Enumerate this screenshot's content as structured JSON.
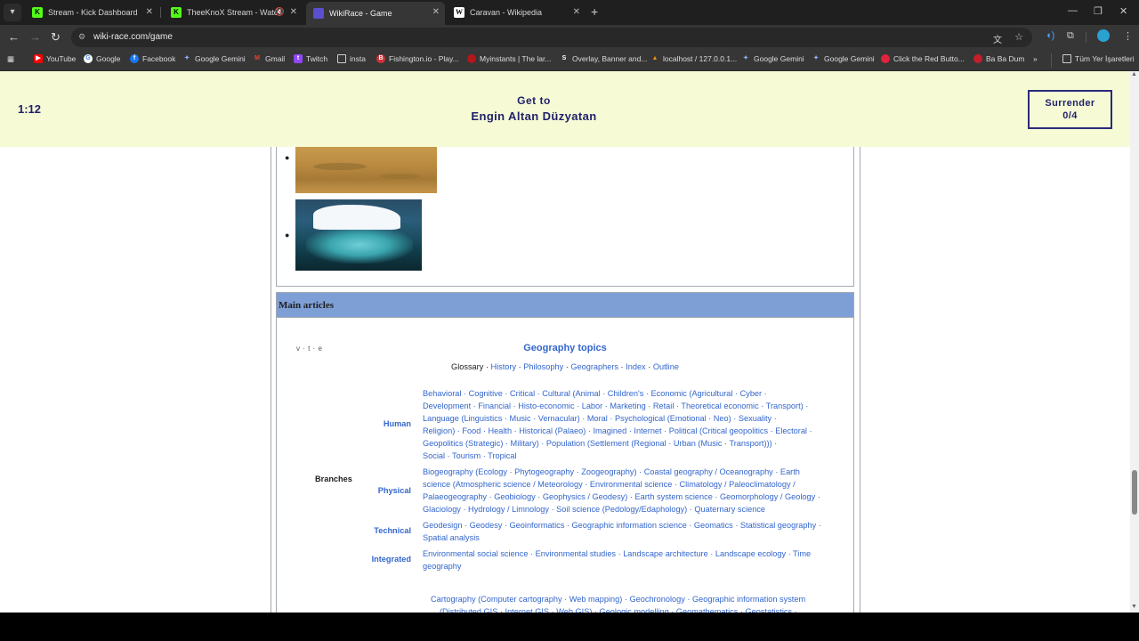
{
  "browser": {
    "tabs": [
      {
        "title": "Stream - Kick Dashboard",
        "fav": "K",
        "favColor": "#53fc18"
      },
      {
        "title": "TheeKnoX Stream - Watch L",
        "fav": "K",
        "favColor": "#53fc18"
      },
      {
        "title": "WikiRace - Game",
        "fav": "",
        "favColor": "#5a4fcf"
      },
      {
        "title": "Caravan - Wikipedia",
        "fav": "W",
        "favColor": "#ffffff"
      }
    ],
    "url": "wiki-race.com/game",
    "bookmarks": [
      "YouTube",
      "Google",
      "Facebook",
      "Google Gemini",
      "Gmail",
      "Twitch",
      "insta",
      "Fishington.io - Play...",
      "Myinstants | The lar...",
      "Overlay, Banner and...",
      "localhost / 127.0.0.1...",
      "Google Gemini",
      "Google Gemini",
      "Click the Red Butto...",
      "Ba Ba Dum",
      "Tüm Yer İşaretleri"
    ],
    "more_bookmarks": "»"
  },
  "game": {
    "timer": "1:12",
    "goal_label": "Get to",
    "goal_target": "Engin Altan Düzyatan",
    "surrender_label": "Surrender",
    "surrender_count": "0/4"
  },
  "article": {
    "main_articles_heading": "Main articles",
    "navbox": {
      "vte": "v · t · e",
      "title": "Geography topics",
      "below": [
        "Glossary",
        "History",
        "Philosophy",
        "Geographers",
        "Index",
        "Outline"
      ],
      "branches_label": "Branches",
      "groups": {
        "human": "Human",
        "physical": "Physical",
        "technical": "Technical",
        "integrated": "Integrated"
      },
      "human_lines": [
        "Behavioral · Cognitive · Critical · Cultural     (Animal · Children's · Economic     (Agricultural · Cyber ·",
        "Development · Financial · Histo-economic · Labor · Marketing · Retail · Theoretical economic · Transport) ·",
        "Language     (Linguistics · Music · Vernacular) · Moral · Psychological     (Emotional · Neo) · Sexuality ·",
        "Religion) · Food · Health · Historical     (Palaeo) · Imagined · Internet · Political     (Critical geopolitics · Electoral ·",
        "Geopolitics     (Strategic) · Military) · Population     (Settlement     (Regional · Urban     (Music · Transport))) ·",
        "Social · Tourism · Tropical"
      ],
      "physical_lines": [
        "Biogeography     (Ecology · Phytogeography · Zoogeography) · Coastal geography / Oceanography · Earth",
        "science     (Atmospheric science / Meteorology · Environmental science · Climatology / Paleoclimatology /",
        "Palaeogeography · Geobiology · Geophysics / Geodesy) · Earth system science · Geomorphology / Geology ·",
        "Glaciology · Hydrology / Limnology · Soil science (Pedology/Edaphology) · Quaternary science"
      ],
      "technical_lines": [
        "Geodesign · Geodesy · Geoinformatics · Geographic information science · Geomatics · Statistical geography ·",
        "Spatial analysis"
      ],
      "integrated_lines": [
        "Environmental social science · Environmental studies · Landscape architecture · Landscape ecology · Time",
        "geography"
      ],
      "techniques_lines": [
        "Cartography     (Computer cartography · Web mapping) · Geochronology · Geographic information system",
        "(Distributed GIS · Internet GIS · Web GIS) · Geologic modelling · Geomathematics · Geostatistics ·"
      ]
    }
  }
}
